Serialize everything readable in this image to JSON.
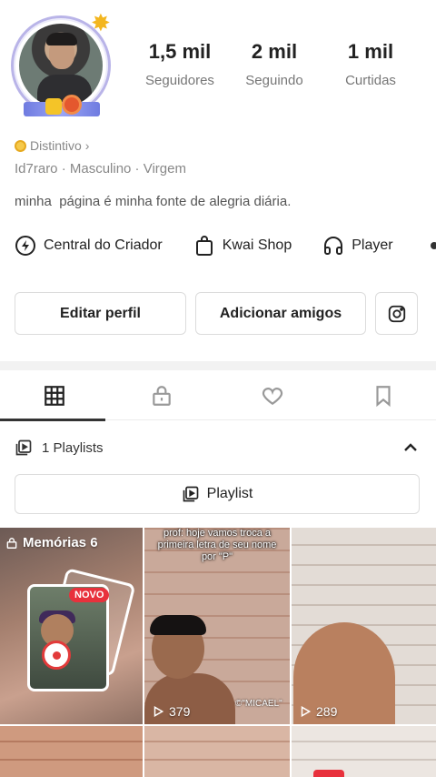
{
  "profile": {
    "stats": [
      {
        "value": "1,5 mil",
        "label": "Seguidores"
      },
      {
        "value": "2 mil",
        "label": "Seguindo"
      },
      {
        "value": "1 mil",
        "label": "Curtidas"
      }
    ],
    "badge_label": "Distintivo",
    "badge_chevron": "›",
    "meta": "Id7raro  ·  Masculino  ·  Virgem",
    "bio": "minha  página é minha fonte de alegria diária."
  },
  "links": [
    {
      "label": "Central do Criador",
      "icon": "lightning-icon"
    },
    {
      "label": "Kwai Shop",
      "icon": "shopping-bag-icon"
    },
    {
      "label": "Player",
      "icon": "headphones-icon"
    }
  ],
  "actions": {
    "edit_profile": "Editar perfil",
    "add_friends": "Adicionar amigos",
    "instagram_icon": "instagram-icon"
  },
  "tabs": [
    {
      "icon": "grid-icon",
      "active": true
    },
    {
      "icon": "lock-icon",
      "active": false
    },
    {
      "icon": "heart-icon",
      "active": false
    },
    {
      "icon": "bookmark-icon",
      "active": false
    }
  ],
  "playlists": {
    "count_label": "1 Playlists",
    "button_label": "Playlist"
  },
  "grid": {
    "memories_label": "Memórias 6",
    "new_badge": "NOVO",
    "video2_caption": "prof: hoje vamos troca a primeira letra de seu nome por \"P\"",
    "video2_watermark": "©\"MICAEL\"",
    "video2_views": "379",
    "video3_views": "289"
  },
  "colors": {
    "accent_red": "#e8313c",
    "badge_gold": "#f6c94a",
    "avatar_ring": "#b9b4e8"
  }
}
